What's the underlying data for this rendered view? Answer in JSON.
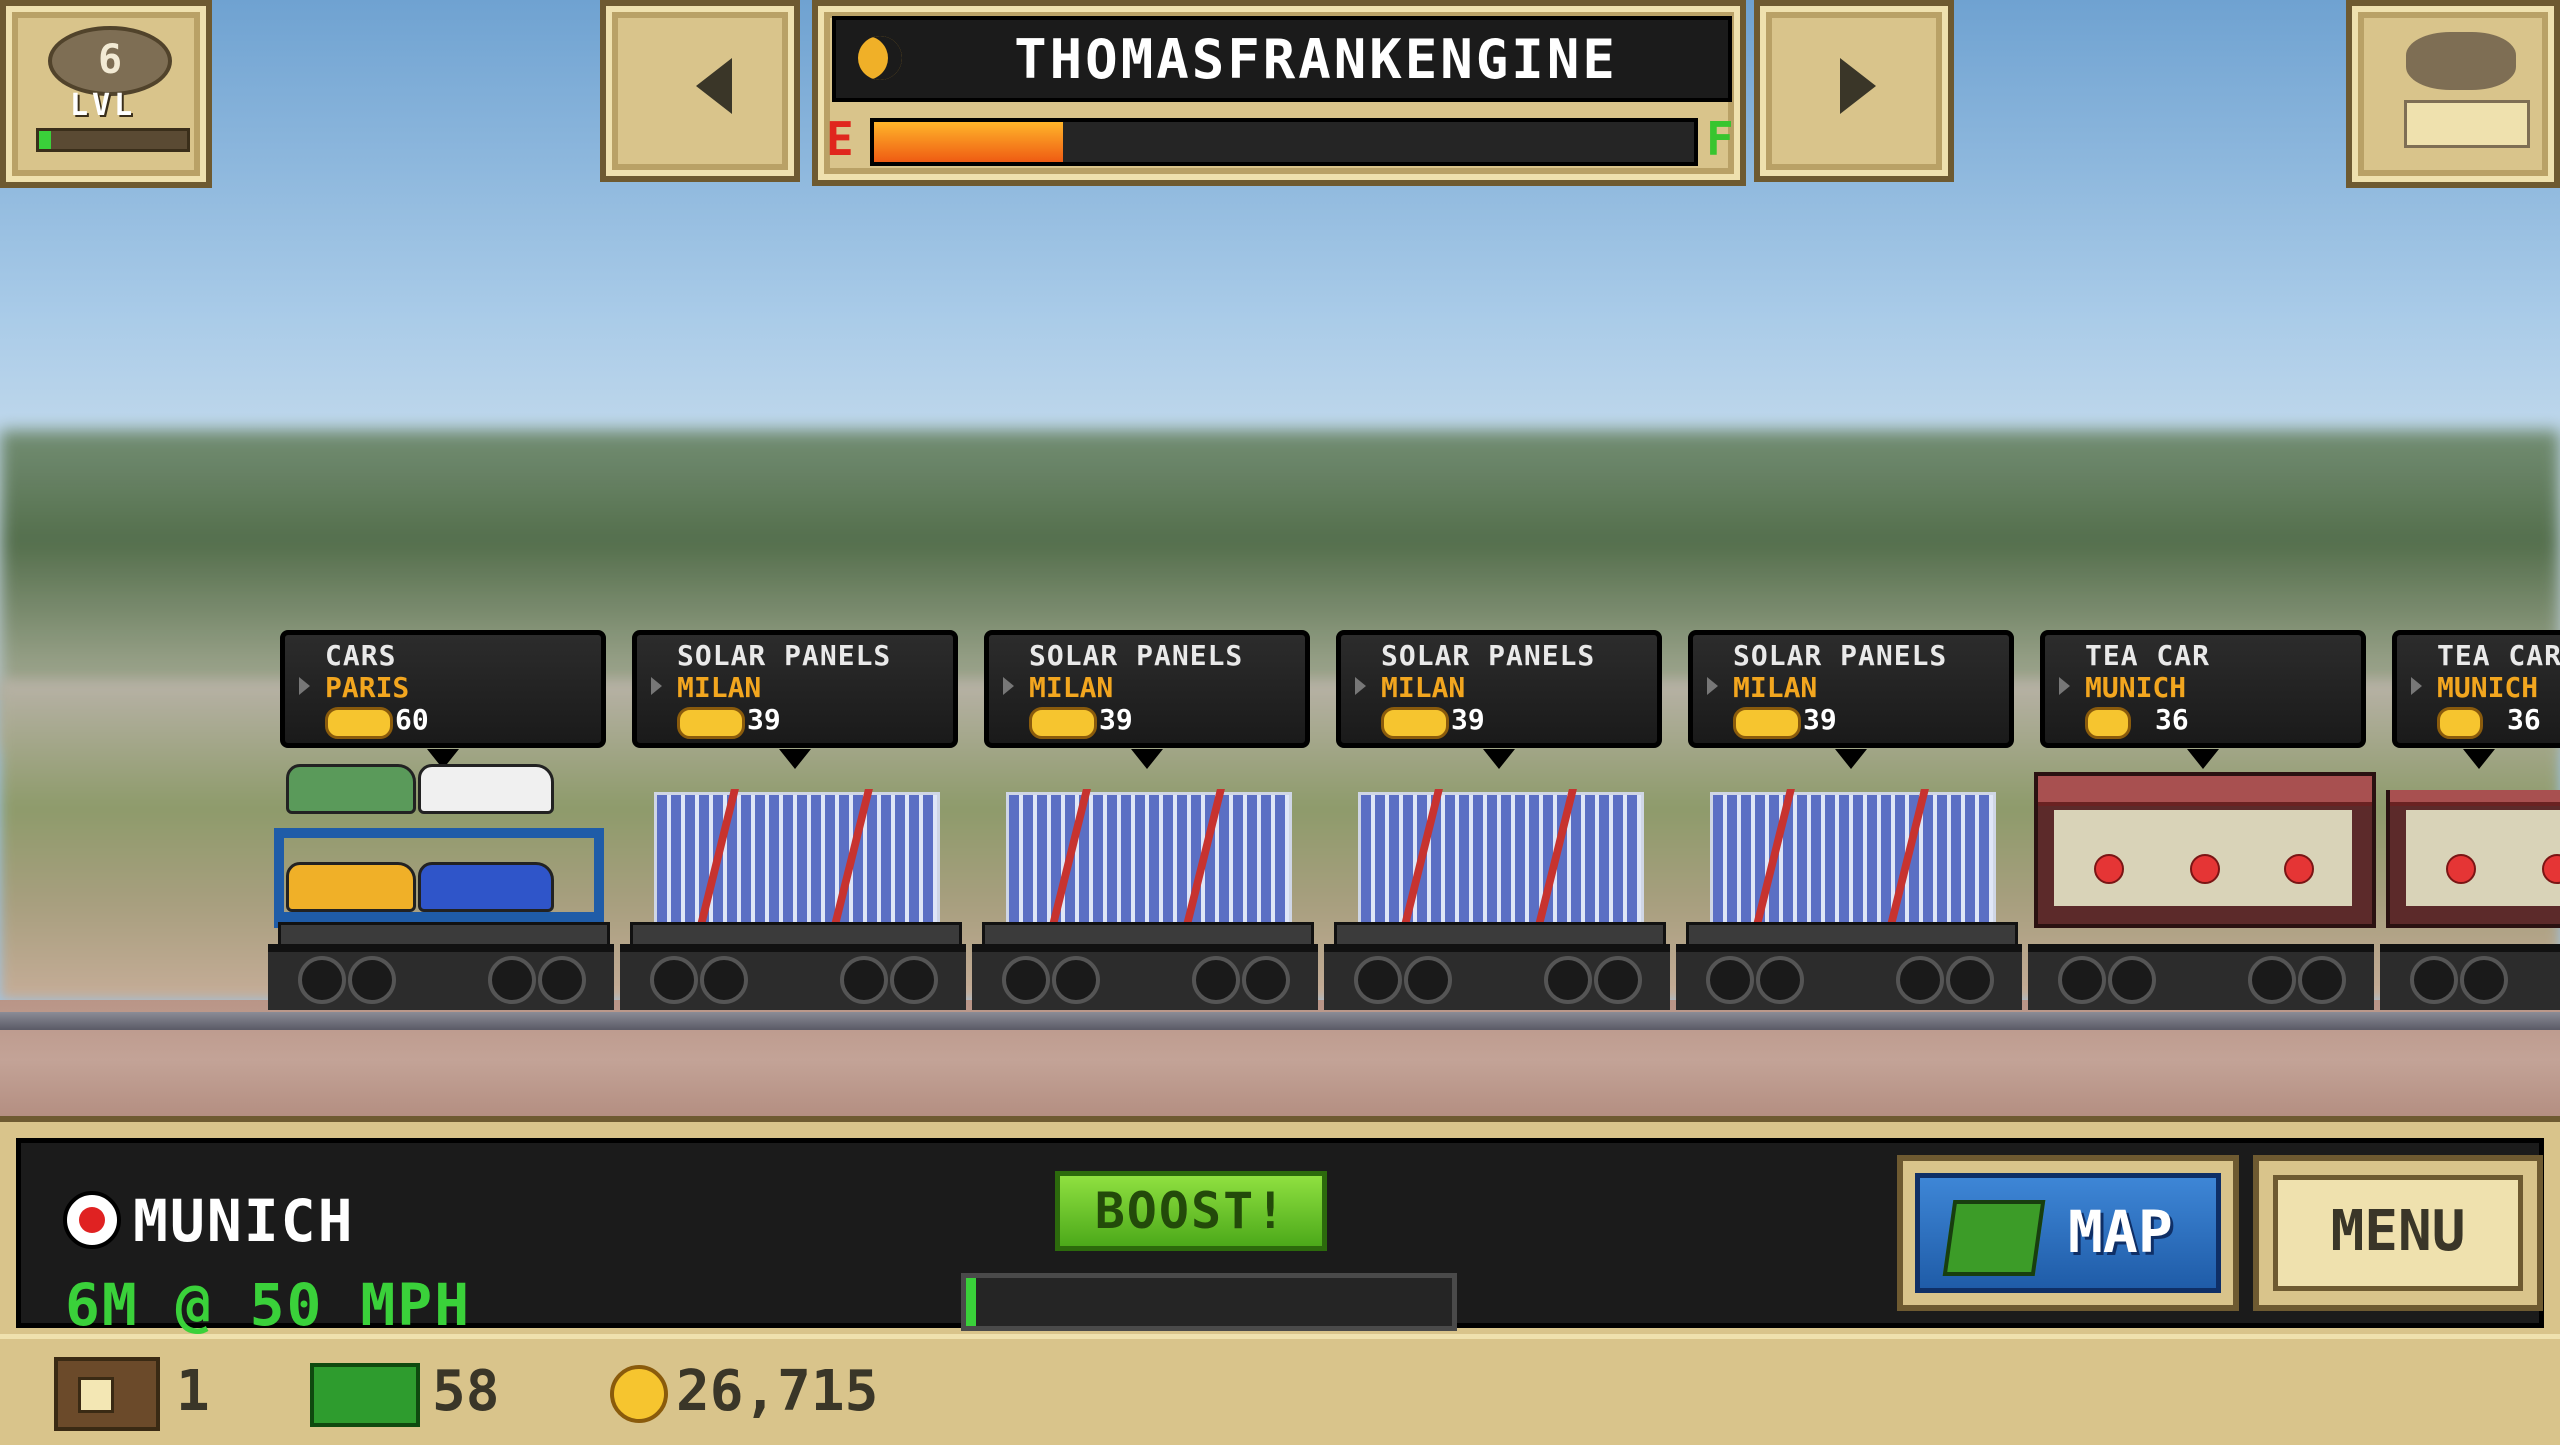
{
  "hud_top": {
    "level": "6",
    "level_label": "LVL",
    "level_progress": 0.08,
    "engine_name": "THOMASFRANKENGINE",
    "fuel_empty_label": "E",
    "fuel_full_label": "F",
    "fuel_level": 0.23
  },
  "cargo": [
    {
      "name": "CARS",
      "destination": "PARIS",
      "payout": "60"
    },
    {
      "name": "SOLAR PANELS",
      "destination": "MILAN",
      "payout": "39"
    },
    {
      "name": "SOLAR PANELS",
      "destination": "MILAN",
      "payout": "39"
    },
    {
      "name": "SOLAR PANELS",
      "destination": "MILAN",
      "payout": "39"
    },
    {
      "name": "SOLAR PANELS",
      "destination": "MILAN",
      "payout": "39"
    },
    {
      "name": "TEA CAR",
      "destination": "MUNICH",
      "payout": "36"
    },
    {
      "name": "TEA CAR",
      "destination": "MUNICH",
      "payout": "36"
    }
  ],
  "hud_bottom": {
    "station": "MUNICH",
    "distance_speed": "6M @ 50 MPH",
    "boost_label": "BOOST!",
    "boost_level": 0.02,
    "map_label": "MAP",
    "menu_label": "MENU"
  },
  "status": {
    "tickets": "1",
    "cash": "58",
    "coins": "26,715"
  },
  "colors": {
    "panel": "#d9c48b",
    "accent_green": "#3ad13a",
    "fuel_orange": "#ef5b13",
    "label_orange": "#f2a61f"
  },
  "icons": [
    "level-icon",
    "left-arrow-icon",
    "right-arrow-icon",
    "engine-icon",
    "train-icon",
    "coin-icon",
    "station-stop-icon",
    "map-icon",
    "ticket-icon",
    "cash-icon"
  ]
}
